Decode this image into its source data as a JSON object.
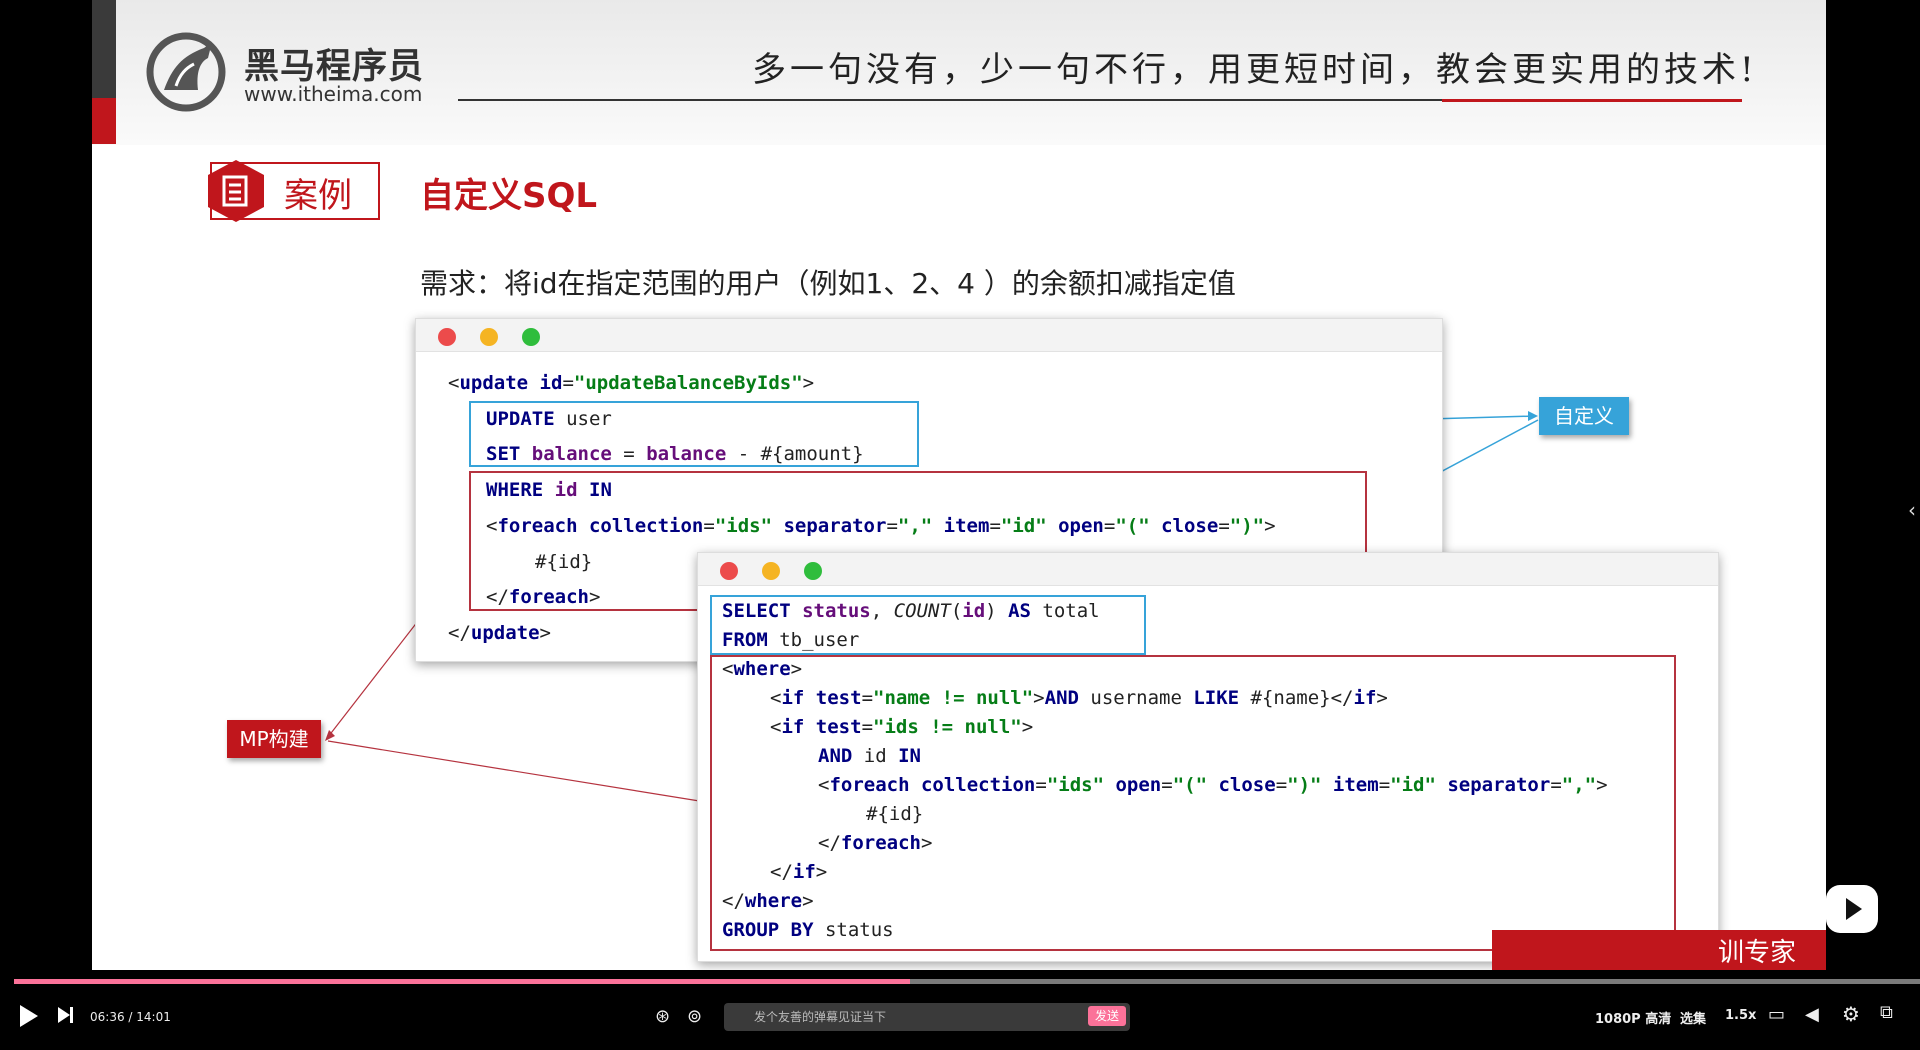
{
  "header": {
    "logo_cn": "黑马程序员",
    "logo_url": "www.itheima.com",
    "slogan": "多一句没有，少一句不行，用更短时间，教会更实用的技术!"
  },
  "slide": {
    "case_label": "案例",
    "title": "自定义SQL",
    "requirement": "需求：将id在指定范围的用户（例如1、2、4 ）的余额扣减指定值"
  },
  "tags": {
    "custom": "自定义",
    "mp": "MP构建"
  },
  "window1": {
    "lines": [
      "<update id=\"updateBalanceByIds\">",
      "UPDATE user",
      "SET balance = balance - #{amount}",
      "WHERE id IN",
      "<foreach collection=\"ids\" separator=\",\" item=\"id\" open=\"(\" close=\")\">",
      "#{id}",
      "</foreach>",
      "</update>"
    ]
  },
  "window2": {
    "lines": [
      "SELECT status, COUNT(id) AS total",
      "FROM tb_user",
      "<where>",
      "<if test=\"name != null\">AND username LIKE #{name}</if>",
      "<if test=\"ids != null\">",
      "AND id IN",
      "<foreach collection=\"ids\" open=\"(\" close=\")\" item=\"id\" separator=\",\">",
      "#{id}",
      "</foreach>",
      "</if>",
      "</where>",
      "GROUP BY status"
    ]
  },
  "player": {
    "time": "06:36 / 14:01",
    "danmaku_placeholder": "发个友善的弹幕见证当下",
    "send_label": "发送",
    "quality": "1080P 高清",
    "episodes": "选集",
    "speed": "1.5x",
    "progress": 0.47,
    "watermark": "训专家"
  },
  "colors": {
    "accent_red": "#c0161c",
    "blue_box": "#36a3d9",
    "progress": "#fb7299"
  }
}
